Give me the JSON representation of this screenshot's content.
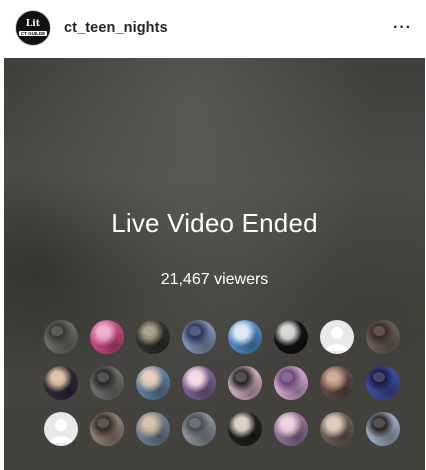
{
  "header": {
    "avatar_text": "Lit",
    "avatar_subtext": "CT GUILDE",
    "username": "ct_teen_nights",
    "more_icon": "ellipsis-horizontal-icon",
    "more_label": "···"
  },
  "live": {
    "title": "Live Video Ended",
    "viewers_label": "21,467 viewers"
  },
  "viewer_avatars": [
    {
      "bg": "#6b6b64",
      "accent": "#3b3a35"
    },
    {
      "bg": "#c0467e",
      "accent": "#e8a3c7"
    },
    {
      "bg": "#2f2f2d",
      "accent": "#9a8f78"
    },
    {
      "bg": "#7d8fb0",
      "accent": "#2c3b63"
    },
    {
      "bg": "#4a86c1",
      "accent": "#d8e7f2"
    },
    {
      "bg": "#111111",
      "accent": "#cfcfcf"
    },
    {
      "bg": "default",
      "accent": ""
    },
    {
      "bg": "#6a5d58",
      "accent": "#3d2e28"
    },
    {
      "bg": "#2d2738",
      "accent": "#d8b79a"
    },
    {
      "bg": "#6e6b6c",
      "accent": "#2e2b2b"
    },
    {
      "bg": "#5c7e9e",
      "accent": "#e1c7b3"
    },
    {
      "bg": "#7a5f8f",
      "accent": "#f1d3e2"
    },
    {
      "bg": "#c6a6b8",
      "accent": "#2d2d2d"
    },
    {
      "bg": "#caa2c8",
      "accent": "#6d4a7b"
    },
    {
      "bg": "#5a4a47",
      "accent": "#c49a86"
    },
    {
      "bg": "#3d4d9c",
      "accent": "#1c1e4a"
    },
    {
      "bg": "default",
      "accent": ""
    },
    {
      "bg": "#8c7b70",
      "accent": "#3b302a"
    },
    {
      "bg": "#6d7c8f",
      "accent": "#cbb79c"
    },
    {
      "bg": "#8a8e96",
      "accent": "#4c5059"
    },
    {
      "bg": "#1f1f1f",
      "accent": "#d6c9bd"
    },
    {
      "bg": "#8c6f92",
      "accent": "#e6ccd8"
    },
    {
      "bg": "#6b5b52",
      "accent": "#d9c3b1"
    },
    {
      "bg": "#9aa7bb",
      "accent": "#2f2b2f"
    }
  ]
}
